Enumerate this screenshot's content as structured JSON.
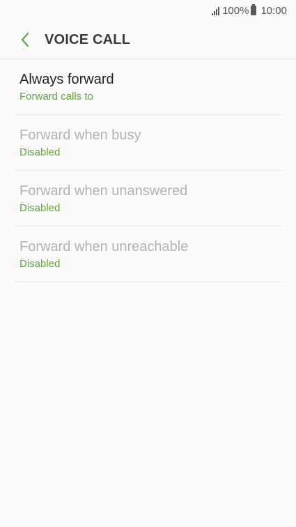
{
  "status_bar": {
    "battery_percent": "100%",
    "time": "10:00"
  },
  "header": {
    "title": "VOICE CALL",
    "accent_color": "#5aa93b"
  },
  "items": [
    {
      "label": "Always forward",
      "sublabel": "Forward calls to",
      "enabled": true
    },
    {
      "label": "Forward when busy",
      "sublabel": "Disabled",
      "enabled": false
    },
    {
      "label": "Forward when unanswered",
      "sublabel": "Disabled",
      "enabled": false
    },
    {
      "label": "Forward when unreachable",
      "sublabel": "Disabled",
      "enabled": false
    }
  ]
}
